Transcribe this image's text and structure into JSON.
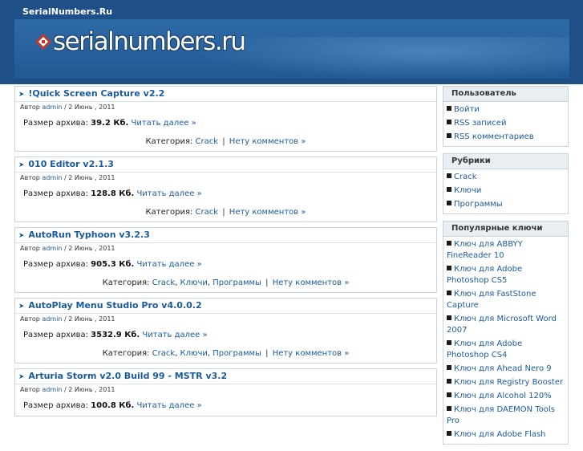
{
  "site": {
    "title": "SerialNumbers.Ru",
    "logo_text": "serialnumbers.ru"
  },
  "posts": [
    {
      "title": "!Quick Screen Capture v2.2",
      "meta_prefix": "Автор",
      "author": "admin",
      "date": "/ 2 Июнь , 2011",
      "size_label": "Размер архива:",
      "size_value": "39.2 Кб.",
      "read_more": "Читать далее »",
      "cat_label": "Категория:",
      "categories": [
        "Crack"
      ],
      "comments": "Нету комментов »"
    },
    {
      "title": "010 Editor v2.1.3",
      "meta_prefix": "Автор",
      "author": "admin",
      "date": "/ 2 Июнь , 2011",
      "size_label": "Размер архива:",
      "size_value": "128.8 Кб.",
      "read_more": "Читать далее »",
      "cat_label": "Категория:",
      "categories": [
        "Crack"
      ],
      "comments": "Нету комментов »"
    },
    {
      "title": "AutoRun Typhoon v3.2.3",
      "meta_prefix": "Автор",
      "author": "admin",
      "date": "/ 2 Июнь , 2011",
      "size_label": "Размер архива:",
      "size_value": "905.3 Кб.",
      "read_more": "Читать далее »",
      "cat_label": "Категория:",
      "categories": [
        "Crack",
        "Ключи",
        "Программы"
      ],
      "comments": "Нету комментов »"
    },
    {
      "title": "AutoPlay Menu Studio Pro v4.0.0.2",
      "meta_prefix": "Автор",
      "author": "admin",
      "date": "/ 2 Июнь , 2011",
      "size_label": "Размер архива:",
      "size_value": "3532.9 Кб.",
      "read_more": "Читать далее »",
      "cat_label": "Категория:",
      "categories": [
        "Crack",
        "Ключи",
        "Программы"
      ],
      "comments": "Нету комментов »"
    },
    {
      "title": "Arturia Storm v2.0 Build 99 - MSTR v3.2",
      "meta_prefix": "Автор",
      "author": "admin",
      "date": "/ 2 Июнь , 2011",
      "size_label": "Размер архива:",
      "size_value": "100.8 Кб.",
      "read_more": "Читать далее »",
      "cat_label": "",
      "categories": [],
      "comments": ""
    }
  ],
  "sidebar": {
    "user": {
      "title": "Пользователь",
      "items": [
        "Войти",
        "RSS записей",
        "RSS комментариев"
      ]
    },
    "rubrics": {
      "title": "Рубрики",
      "items": [
        "Crack",
        "Ключи",
        "Программы"
      ]
    },
    "popular": {
      "title": "Популярные ключи",
      "items": [
        "Ключ для ABBYY FineReader 10",
        "Ключ для Adobe Photoshop CS5",
        "Ключ для FastStone Capture",
        "Ключ для Microsoft Word 2007",
        "Ключ для Adobe Photoshop CS4",
        "Ключ для Ahead Nero 9",
        "Ключ для Registry Booster",
        "Ключ для Alcohol 120%",
        "Ключ для DAEMON Tools Pro",
        "Ключ для Adobe Flash"
      ]
    }
  }
}
